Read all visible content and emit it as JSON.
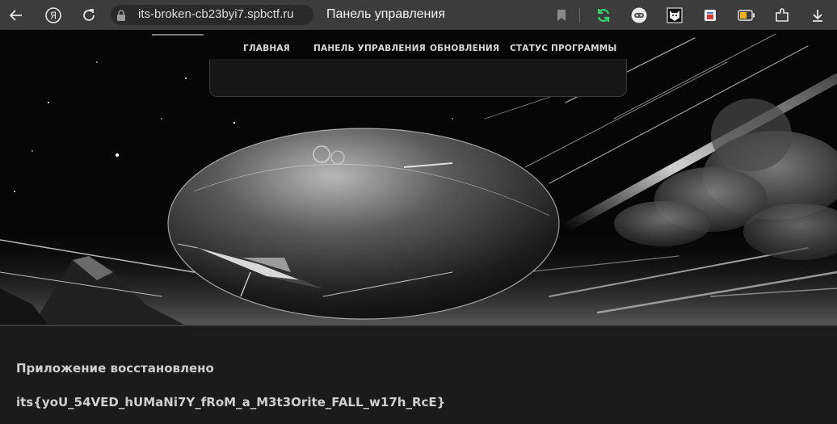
{
  "browser": {
    "url": "its-broken-cb23byi7.spbctf.ru",
    "tab_title": "Панель управления",
    "icons": [
      "back-arrow-icon",
      "yandex-logo-icon",
      "reload-icon",
      "lock-icon",
      "bookmark-icon",
      "sync-extension-icon",
      "bot-extension-icon",
      "fox-extension-icon",
      "collections-icon",
      "battery-icon",
      "extensions-icon",
      "download-icon"
    ],
    "accent": "#3bd16f"
  },
  "nav": {
    "items": [
      {
        "label": "ГЛАВНАЯ"
      },
      {
        "label": "ПАНЕЛЬ УПРАВЛЕНИЯ"
      },
      {
        "label": "ОБНОВЛЕНИЯ"
      },
      {
        "label": "СТАТУС ПРОГРАММЫ"
      }
    ]
  },
  "content": {
    "status_message": "Приложение восстановлено",
    "flag": "its{yoU_54VED_hUMaNi7Y_fRoM_a_M3t3Orite_FALL_w17h_RcE}"
  },
  "hero": {
    "image": "space-planet-spaceship-illustration",
    "style": "monochrome"
  }
}
